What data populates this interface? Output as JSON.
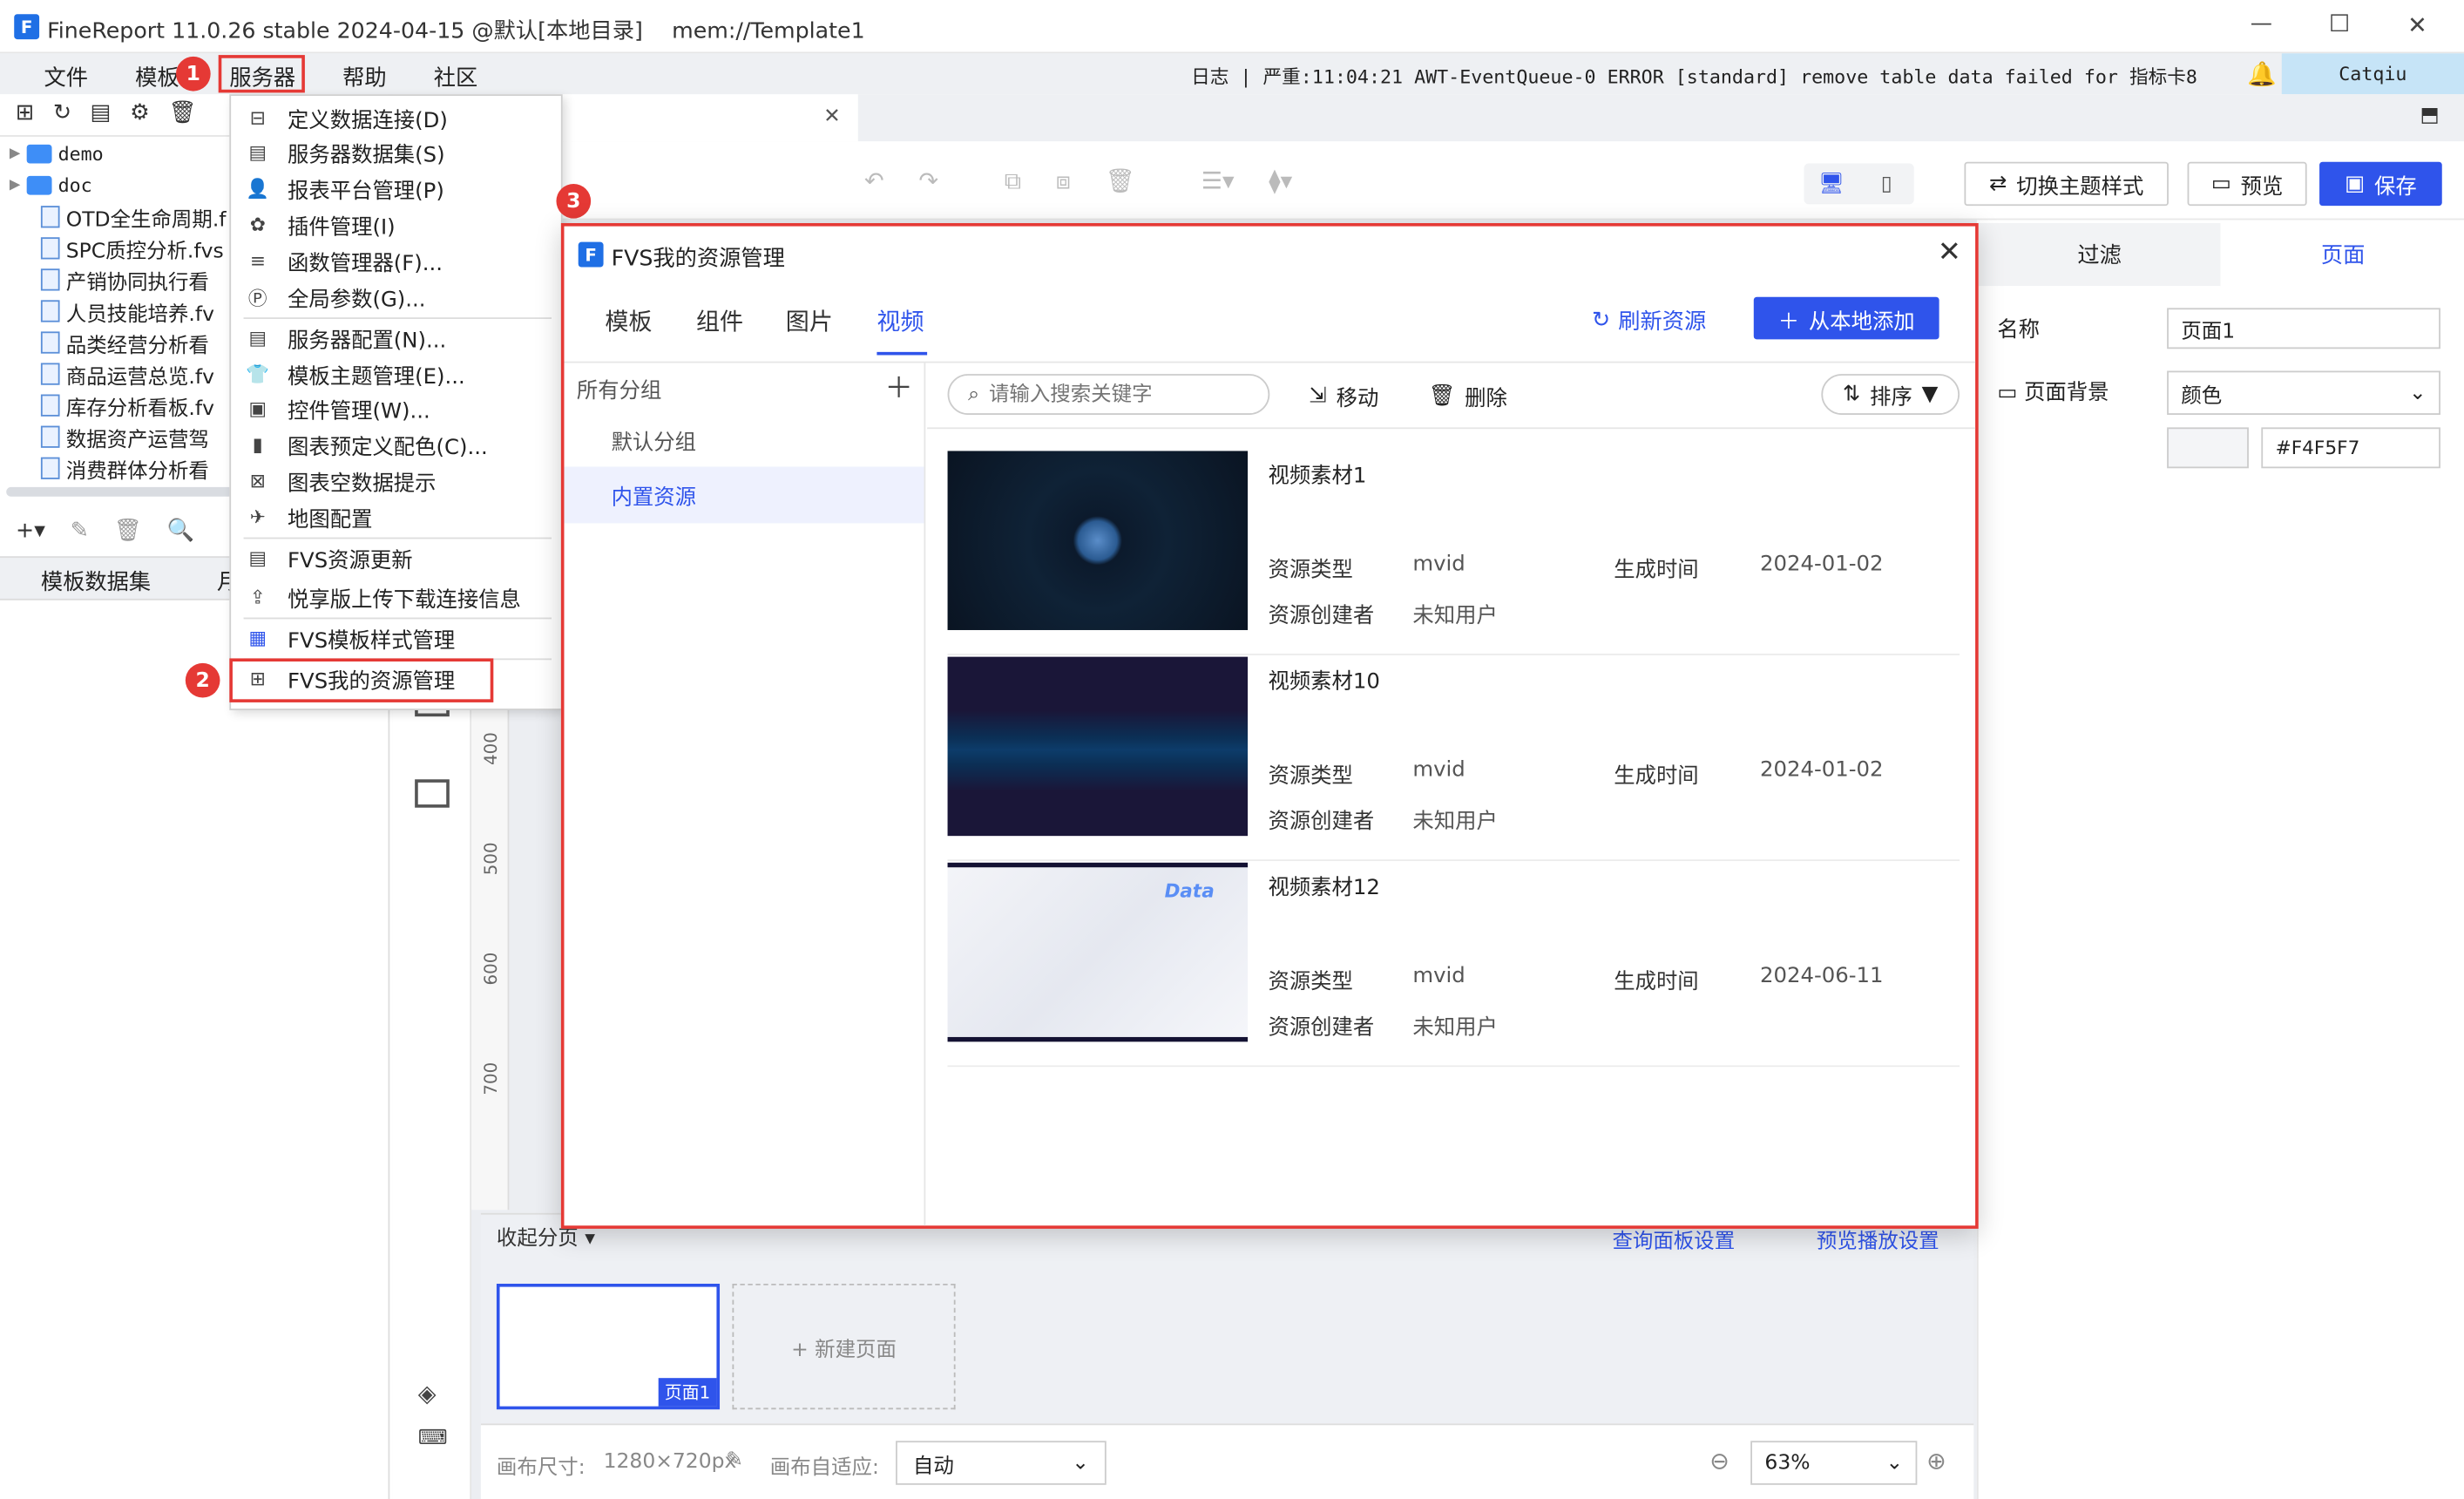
{
  "window": {
    "title": "FineReport 11.0.26 stable 2024-04-15 @默认[本地目录]",
    "path": "mem://Template1",
    "minimize": "—",
    "maximize": "☐",
    "close": "✕"
  },
  "menubar": {
    "items": [
      "文件",
      "模板",
      "服务器",
      "帮助",
      "社区"
    ],
    "log_text": "日志 | 严重:11:04:21 AWT-EventQueue-0 ERROR [standard] remove table data failed for 指标卡8",
    "user": "Catqiu"
  },
  "left_panel": {
    "tree": [
      {
        "label": "demo",
        "type": "folder"
      },
      {
        "label": "doc",
        "type": "folder"
      },
      {
        "label": "OTD全生命周期.f",
        "type": "file"
      },
      {
        "label": "SPC质控分析.fvs",
        "type": "file"
      },
      {
        "label": "产销协同执行看",
        "type": "file"
      },
      {
        "label": "人员技能培养.fv",
        "type": "file"
      },
      {
        "label": "品类经营分析看",
        "type": "file"
      },
      {
        "label": "商品运营总览.fv",
        "type": "file"
      },
      {
        "label": "库存分析看板.fv",
        "type": "file"
      },
      {
        "label": "数据资产运营驾",
        "type": "file"
      },
      {
        "label": "消费群体分析看",
        "type": "file"
      }
    ],
    "dataset_tab": "模板数据集",
    "dataset_tab2": "月"
  },
  "dropdown": {
    "items": [
      {
        "label": "定义数据连接(D)",
        "icon": "database-connect-icon"
      },
      {
        "label": "服务器数据集(S)",
        "icon": "server-dataset-icon"
      },
      {
        "label": "报表平台管理(P)",
        "icon": "user-icon"
      },
      {
        "label": "插件管理(I)",
        "icon": "plugin-icon"
      },
      {
        "label": "函数管理器(F)...",
        "icon": "function-icon"
      },
      {
        "label": "全局参数(G)...",
        "icon": "param-icon"
      },
      {
        "label": "服务器配置(N)...",
        "icon": "server-config-icon"
      },
      {
        "label": "模板主题管理(E)...",
        "icon": "shirt-icon"
      },
      {
        "label": "控件管理(W)...",
        "icon": "widget-icon"
      },
      {
        "label": "图表预定义配色(C)...",
        "icon": "chart-bar-icon"
      },
      {
        "label": "图表空数据提示",
        "icon": "chart-empty-icon"
      },
      {
        "label": "地图配置",
        "icon": "map-icon"
      },
      {
        "label": "FVS资源更新",
        "icon": "update-icon"
      },
      {
        "label": "悦享版上传下载连接信息",
        "icon": "upload-icon"
      },
      {
        "label": "FVS模板样式管理",
        "icon": "fvs-style-icon"
      },
      {
        "label": "FVS我的资源管理",
        "icon": "grid-icon"
      }
    ]
  },
  "callouts": [
    "1",
    "2",
    "3"
  ],
  "toolbar": {
    "theme_btn": "切换主题样式",
    "preview_btn": "预览",
    "save_btn": "保存"
  },
  "right_panel": {
    "tab_filter": "过滤",
    "tab_page": "页面",
    "name_label": "名称",
    "name_value": "页面1",
    "bg_label": "页面背景",
    "bg_value": "颜色",
    "color_hex": "#F4F5F7"
  },
  "canvas": {
    "ruler": [
      "400",
      "500",
      "600",
      "700"
    ],
    "collapse_pages": "收起分页",
    "query_panel": "查询面板设置",
    "preview_play": "预览播放设置",
    "page1": "页面1",
    "new_page": "+ 新建页面",
    "size_label": "画布尺寸:",
    "size_value": "1280×720px",
    "fit_label": "画布自适应:",
    "fit_value": "自动",
    "zoom": "63%"
  },
  "dialog": {
    "title": "FVS我的资源管理",
    "tabs": [
      "模板",
      "组件",
      "图片",
      "视频"
    ],
    "active_tab": "视频",
    "refresh": "刷新资源",
    "add_local": "从本地添加",
    "groups_header": "所有分组",
    "groups": [
      "默认分组",
      "内置资源"
    ],
    "search_placeholder": "请输入搜索关键字",
    "move": "移动",
    "delete": "删除",
    "sort": "排序",
    "field_type": "资源类型",
    "field_creator": "资源创建者",
    "field_time": "生成时间",
    "items": [
      {
        "name": "视频素材1",
        "type": "mvid",
        "creator": "未知用户",
        "time": "2024-01-02"
      },
      {
        "name": "视频素材10",
        "type": "mvid",
        "creator": "未知用户",
        "time": "2024-01-02"
      },
      {
        "name": "视频素材12",
        "type": "mvid",
        "creator": "未知用户",
        "time": "2024-06-11"
      }
    ],
    "thumb3_text": "Data"
  },
  "colors": {
    "accent": "#2f54eb",
    "callout_red": "#e53935",
    "user_bg": "#c6e4f7"
  }
}
